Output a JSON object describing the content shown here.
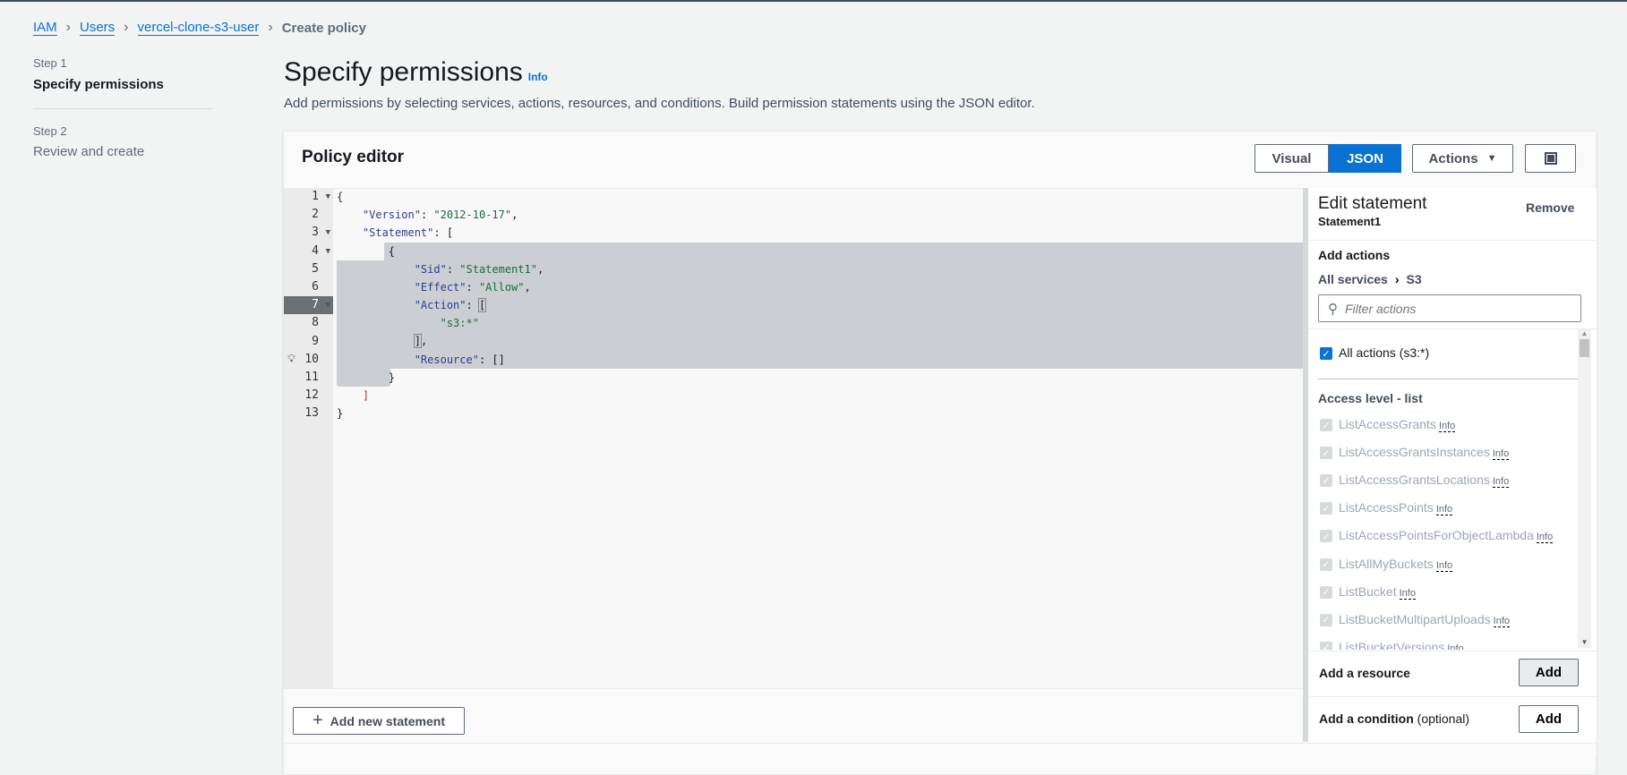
{
  "breadcrumb": [
    {
      "label": "IAM"
    },
    {
      "label": "Users"
    },
    {
      "label": "vercel-clone-s3-user"
    }
  ],
  "breadcrumb_current": "Create policy",
  "steps": [
    {
      "label": "Step 1",
      "title": "Specify permissions",
      "active": true
    },
    {
      "label": "Step 2",
      "title": "Review and create",
      "active": false
    }
  ],
  "page": {
    "title": "Specify permissions",
    "info": "Info",
    "subtitle": "Add permissions by selecting services, actions, resources, and conditions. Build permission statements using the JSON editor."
  },
  "editor": {
    "title": "Policy editor",
    "tabs": {
      "visual": "Visual",
      "json": "JSON",
      "selected": "JSON"
    },
    "actions_label": "Actions",
    "active_line": 7,
    "lines": [
      "1",
      "2",
      "3",
      "4",
      "5",
      "6",
      "7",
      "8",
      "9",
      "10",
      "11",
      "12",
      "13"
    ],
    "add_statement": "Add new statement"
  },
  "statement": {
    "heading": "Edit statement",
    "name": "Statement1",
    "remove": "Remove",
    "add_actions": "Add actions",
    "all_services": "All services",
    "service": "S3",
    "filter_placeholder": "Filter actions",
    "all_actions": "All actions (s3:*)",
    "access_level": "Access level - list",
    "info": "Info",
    "actions": [
      "ListAccessGrants",
      "ListAccessGrantsInstances",
      "ListAccessGrantsLocations",
      "ListAccessPoints",
      "ListAccessPointsForObjectLambda",
      "ListAllMyBuckets",
      "ListBucket",
      "ListBucketMultipartUploads",
      "ListBucketVersions"
    ],
    "add_resource": "Add a resource",
    "add_condition": "Add a condition",
    "optional": "(optional)",
    "add": "Add"
  },
  "colors": {
    "accent": "#0972d3",
    "selection": "#cbced2"
  }
}
